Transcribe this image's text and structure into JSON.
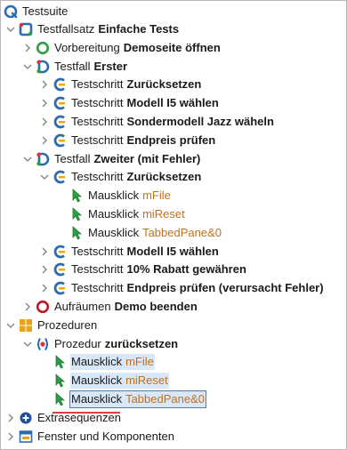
{
  "colors": {
    "accent": "#2b6cb0",
    "highlight": "#d9e8f8",
    "arg": "#c2711b",
    "redline": "#e43b3b"
  },
  "tree": {
    "root": {
      "label": "Testsuite",
      "icon": "q-logo-icon"
    },
    "rows": [
      {
        "indent": 0,
        "chevron": "down",
        "icon": "testcase-set-icon",
        "prefix": "Testfallsatz",
        "bold": "Einfache Tests"
      },
      {
        "indent": 1,
        "chevron": "right",
        "icon": "setup-icon",
        "prefix": "Vorbereitung",
        "bold": "Demoseite öffnen"
      },
      {
        "indent": 1,
        "chevron": "down",
        "icon": "testcase-icon",
        "prefix": "Testfall",
        "bold": "Erster"
      },
      {
        "indent": 2,
        "chevron": "right",
        "icon": "teststep-icon",
        "prefix": "Testschritt",
        "bold": "Zurücksetzen"
      },
      {
        "indent": 2,
        "chevron": "right",
        "icon": "teststep-icon",
        "prefix": "Testschritt",
        "bold": "Modell I5 wählen"
      },
      {
        "indent": 2,
        "chevron": "right",
        "icon": "teststep-icon",
        "prefix": "Testschritt",
        "bold": "Sondermodell Jazz wäheln"
      },
      {
        "indent": 2,
        "chevron": "right",
        "icon": "teststep-icon",
        "prefix": "Testschritt",
        "bold": "Endpreis prüfen"
      },
      {
        "indent": 1,
        "chevron": "down",
        "icon": "testcase-icon",
        "prefix": "Testfall",
        "bold": "Zweiter (mit Fehler)"
      },
      {
        "indent": 2,
        "chevron": "down",
        "icon": "teststep-icon",
        "prefix": "Testschritt",
        "bold": "Zurücksetzen"
      },
      {
        "indent": 3,
        "chevron": "none",
        "icon": "mouse-click-icon",
        "prefix": "Mausklick",
        "arg": "mFile"
      },
      {
        "indent": 3,
        "chevron": "none",
        "icon": "mouse-click-icon",
        "prefix": "Mausklick",
        "arg": "miReset"
      },
      {
        "indent": 3,
        "chevron": "none",
        "icon": "mouse-click-icon",
        "prefix": "Mausklick",
        "arg": "TabbedPane&0"
      },
      {
        "indent": 2,
        "chevron": "right",
        "icon": "teststep-icon",
        "prefix": "Testschritt",
        "bold": "Modell I5 wählen"
      },
      {
        "indent": 2,
        "chevron": "right",
        "icon": "teststep-icon",
        "prefix": "Testschritt",
        "bold": "10% Rabatt gewähren"
      },
      {
        "indent": 2,
        "chevron": "right",
        "icon": "teststep-icon",
        "prefix": "Testschritt",
        "bold": "Endpreis prüfen (verursacht Fehler)"
      },
      {
        "indent": 1,
        "chevron": "right",
        "icon": "cleanup-icon",
        "prefix": "Aufräumen",
        "bold": "Demo beenden"
      },
      {
        "indent": 0,
        "chevron": "down",
        "icon": "procedures-icon",
        "prefix": "Prozeduren"
      },
      {
        "indent": 1,
        "chevron": "down",
        "icon": "procedure-icon",
        "prefix": "Prozedur",
        "bold": "zurücksetzen"
      },
      {
        "indent": 2,
        "chevron": "none",
        "icon": "mouse-click-icon",
        "prefix": "Mausklick",
        "arg": "mFile",
        "state": "selected"
      },
      {
        "indent": 2,
        "chevron": "none",
        "icon": "mouse-click-icon",
        "prefix": "Mausklick",
        "arg": "miReset",
        "state": "selected"
      },
      {
        "indent": 2,
        "chevron": "none",
        "icon": "mouse-click-icon",
        "prefix": "Mausklick",
        "arg": "TabbedPane&0",
        "state": "focused"
      },
      {
        "indent": 0,
        "chevron": "right",
        "icon": "extrasequences-icon",
        "prefix": "Extrasequenzen"
      },
      {
        "indent": 0,
        "chevron": "right",
        "icon": "windows-components-icon",
        "prefix": "Fenster und Komponenten"
      }
    ]
  }
}
